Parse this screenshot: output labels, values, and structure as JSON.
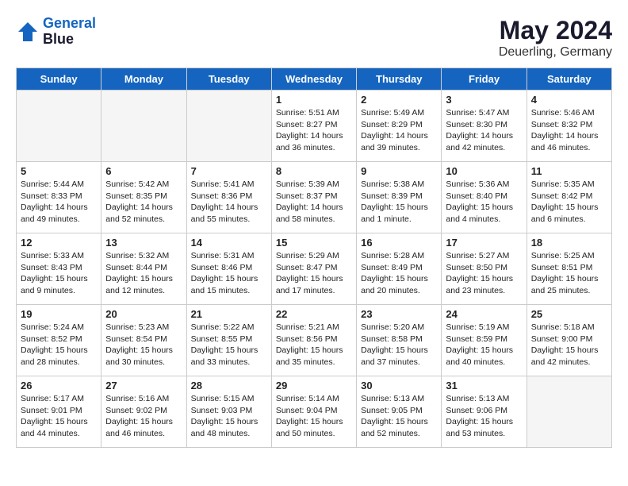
{
  "logo": {
    "line1": "General",
    "line2": "Blue"
  },
  "title": "May 2024",
  "location": "Deuerling, Germany",
  "days_of_week": [
    "Sunday",
    "Monday",
    "Tuesday",
    "Wednesday",
    "Thursday",
    "Friday",
    "Saturday"
  ],
  "weeks": [
    [
      {
        "day": "",
        "empty": true
      },
      {
        "day": "",
        "empty": true
      },
      {
        "day": "",
        "empty": true
      },
      {
        "day": "1",
        "sunrise": "5:51 AM",
        "sunset": "8:27 PM",
        "daylight": "14 hours and 36 minutes."
      },
      {
        "day": "2",
        "sunrise": "5:49 AM",
        "sunset": "8:29 PM",
        "daylight": "14 hours and 39 minutes."
      },
      {
        "day": "3",
        "sunrise": "5:47 AM",
        "sunset": "8:30 PM",
        "daylight": "14 hours and 42 minutes."
      },
      {
        "day": "4",
        "sunrise": "5:46 AM",
        "sunset": "8:32 PM",
        "daylight": "14 hours and 46 minutes."
      }
    ],
    [
      {
        "day": "5",
        "sunrise": "5:44 AM",
        "sunset": "8:33 PM",
        "daylight": "14 hours and 49 minutes."
      },
      {
        "day": "6",
        "sunrise": "5:42 AM",
        "sunset": "8:35 PM",
        "daylight": "14 hours and 52 minutes."
      },
      {
        "day": "7",
        "sunrise": "5:41 AM",
        "sunset": "8:36 PM",
        "daylight": "14 hours and 55 minutes."
      },
      {
        "day": "8",
        "sunrise": "5:39 AM",
        "sunset": "8:37 PM",
        "daylight": "14 hours and 58 minutes."
      },
      {
        "day": "9",
        "sunrise": "5:38 AM",
        "sunset": "8:39 PM",
        "daylight": "15 hours and 1 minute."
      },
      {
        "day": "10",
        "sunrise": "5:36 AM",
        "sunset": "8:40 PM",
        "daylight": "15 hours and 4 minutes."
      },
      {
        "day": "11",
        "sunrise": "5:35 AM",
        "sunset": "8:42 PM",
        "daylight": "15 hours and 6 minutes."
      }
    ],
    [
      {
        "day": "12",
        "sunrise": "5:33 AM",
        "sunset": "8:43 PM",
        "daylight": "15 hours and 9 minutes."
      },
      {
        "day": "13",
        "sunrise": "5:32 AM",
        "sunset": "8:44 PM",
        "daylight": "15 hours and 12 minutes."
      },
      {
        "day": "14",
        "sunrise": "5:31 AM",
        "sunset": "8:46 PM",
        "daylight": "15 hours and 15 minutes."
      },
      {
        "day": "15",
        "sunrise": "5:29 AM",
        "sunset": "8:47 PM",
        "daylight": "15 hours and 17 minutes."
      },
      {
        "day": "16",
        "sunrise": "5:28 AM",
        "sunset": "8:49 PM",
        "daylight": "15 hours and 20 minutes."
      },
      {
        "day": "17",
        "sunrise": "5:27 AM",
        "sunset": "8:50 PM",
        "daylight": "15 hours and 23 minutes."
      },
      {
        "day": "18",
        "sunrise": "5:25 AM",
        "sunset": "8:51 PM",
        "daylight": "15 hours and 25 minutes."
      }
    ],
    [
      {
        "day": "19",
        "sunrise": "5:24 AM",
        "sunset": "8:52 PM",
        "daylight": "15 hours and 28 minutes."
      },
      {
        "day": "20",
        "sunrise": "5:23 AM",
        "sunset": "8:54 PM",
        "daylight": "15 hours and 30 minutes."
      },
      {
        "day": "21",
        "sunrise": "5:22 AM",
        "sunset": "8:55 PM",
        "daylight": "15 hours and 33 minutes."
      },
      {
        "day": "22",
        "sunrise": "5:21 AM",
        "sunset": "8:56 PM",
        "daylight": "15 hours and 35 minutes."
      },
      {
        "day": "23",
        "sunrise": "5:20 AM",
        "sunset": "8:58 PM",
        "daylight": "15 hours and 37 minutes."
      },
      {
        "day": "24",
        "sunrise": "5:19 AM",
        "sunset": "8:59 PM",
        "daylight": "15 hours and 40 minutes."
      },
      {
        "day": "25",
        "sunrise": "5:18 AM",
        "sunset": "9:00 PM",
        "daylight": "15 hours and 42 minutes."
      }
    ],
    [
      {
        "day": "26",
        "sunrise": "5:17 AM",
        "sunset": "9:01 PM",
        "daylight": "15 hours and 44 minutes."
      },
      {
        "day": "27",
        "sunrise": "5:16 AM",
        "sunset": "9:02 PM",
        "daylight": "15 hours and 46 minutes."
      },
      {
        "day": "28",
        "sunrise": "5:15 AM",
        "sunset": "9:03 PM",
        "daylight": "15 hours and 48 minutes."
      },
      {
        "day": "29",
        "sunrise": "5:14 AM",
        "sunset": "9:04 PM",
        "daylight": "15 hours and 50 minutes."
      },
      {
        "day": "30",
        "sunrise": "5:13 AM",
        "sunset": "9:05 PM",
        "daylight": "15 hours and 52 minutes."
      },
      {
        "day": "31",
        "sunrise": "5:13 AM",
        "sunset": "9:06 PM",
        "daylight": "15 hours and 53 minutes."
      },
      {
        "day": "",
        "empty": true
      }
    ]
  ],
  "labels": {
    "sunrise_prefix": "Sunrise: ",
    "sunset_prefix": "Sunset: ",
    "daylight_prefix": "Daylight: "
  }
}
